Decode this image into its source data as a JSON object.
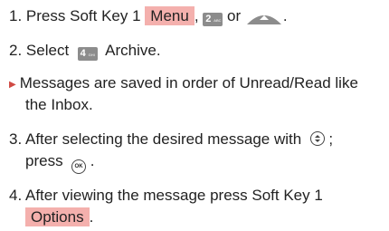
{
  "steps": [
    {
      "number": "1.",
      "text_before": "Press Soft Key 1",
      "highlight": "Menu",
      "comma": ",",
      "key_digit": "2",
      "key_sub": "ABC",
      "or_text": "or",
      "end": "."
    },
    {
      "number": "2.",
      "text_before": "Select",
      "key_digit": "4",
      "key_sub": "GHI",
      "text_after": "Archive."
    },
    {
      "note_line1": "Messages are saved in order of Unread/Read like",
      "note_line2": "the Inbox."
    },
    {
      "number": "3.",
      "line1": "After selecting the desired message with",
      "line1_end": ";",
      "line2": "press",
      "ok_label": "OK",
      "line2_end": "."
    },
    {
      "number": "4.",
      "line1": "After viewing the message press Soft Key 1",
      "highlight": "Options",
      "end": "."
    }
  ],
  "colors": {
    "highlight": "#f4b0ad",
    "key_bg": "#8c8c8c",
    "bullet": "#d04a44",
    "text": "#222222"
  },
  "icons": {
    "menu_key": "menu-arrow-key-icon",
    "nav_key": "up-down-nav-icon",
    "ok_key": "ok-circle-icon",
    "bullet": "triangle-bullet-icon"
  }
}
